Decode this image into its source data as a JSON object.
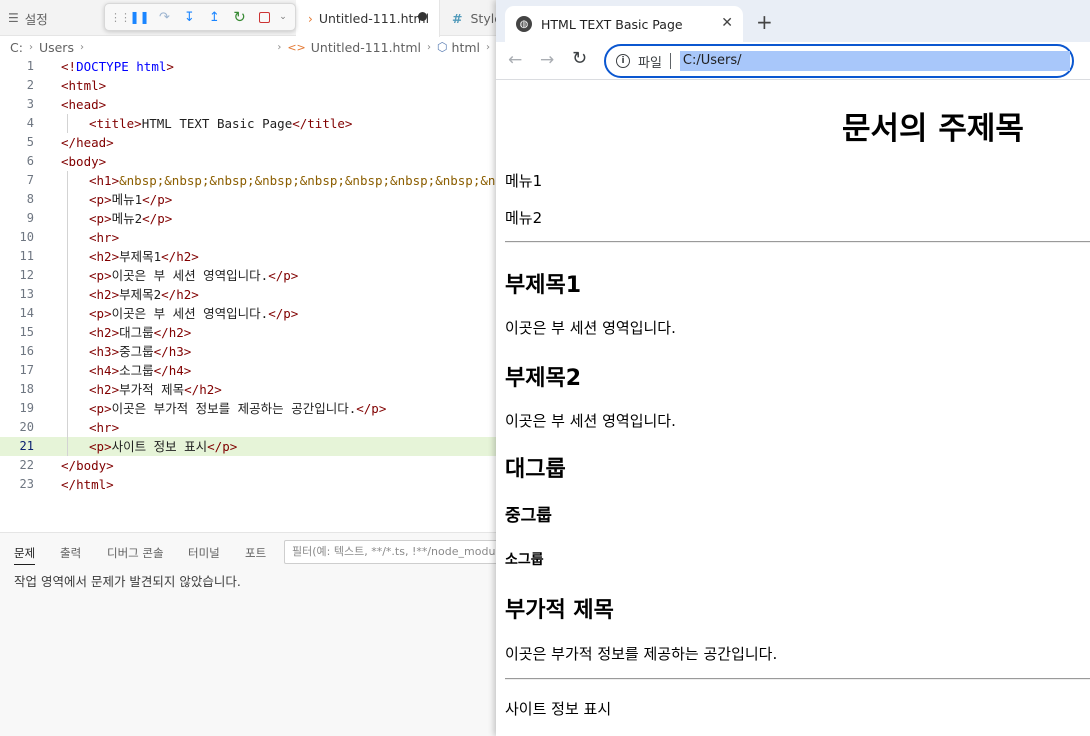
{
  "editor": {
    "tabs": {
      "settings": "설정",
      "file": "Untitled-111.html",
      "style": "Style"
    },
    "breadcrumb": {
      "drive": "C:",
      "users": "Users",
      "file": "Untitled-111.html",
      "node": "html"
    },
    "code_lines": [
      {
        "n": "1",
        "parts": [
          [
            "br",
            "<!"
          ],
          [
            "dt",
            "DOCTYPE"
          ],
          [
            "txt",
            " "
          ],
          [
            "dt",
            "html"
          ],
          [
            "br",
            ">"
          ]
        ]
      },
      {
        "n": "2",
        "parts": [
          [
            "br",
            "<"
          ],
          [
            "tg",
            "html"
          ],
          [
            "br",
            ">"
          ]
        ]
      },
      {
        "n": "3",
        "parts": [
          [
            "br",
            "<"
          ],
          [
            "tg",
            "head"
          ],
          [
            "br",
            ">"
          ]
        ]
      },
      {
        "n": "4",
        "indent": true,
        "parts": [
          [
            "br",
            "<"
          ],
          [
            "tg",
            "title"
          ],
          [
            "br",
            ">"
          ],
          [
            "txt",
            "HTML TEXT Basic Page"
          ],
          [
            "br",
            "</"
          ],
          [
            "tg",
            "title"
          ],
          [
            "br",
            ">"
          ]
        ]
      },
      {
        "n": "5",
        "parts": [
          [
            "br",
            "</"
          ],
          [
            "tg",
            "head"
          ],
          [
            "br",
            ">"
          ]
        ]
      },
      {
        "n": "6",
        "parts": [
          [
            "br",
            "<"
          ],
          [
            "tg",
            "body"
          ],
          [
            "br",
            ">"
          ]
        ]
      },
      {
        "n": "7",
        "indent": true,
        "parts": [
          [
            "br",
            "<"
          ],
          [
            "tg",
            "h1"
          ],
          [
            "br",
            ">"
          ],
          [
            "ent",
            "&nbsp;&nbsp;&nbsp;&nbsp;&nbsp;&nbsp;&nbsp;&nbsp;&nbsp;&"
          ]
        ]
      },
      {
        "n": "8",
        "indent": true,
        "parts": [
          [
            "br",
            "<"
          ],
          [
            "tg",
            "p"
          ],
          [
            "br",
            ">"
          ],
          [
            "txt",
            "메뉴1"
          ],
          [
            "br",
            "</"
          ],
          [
            "tg",
            "p"
          ],
          [
            "br",
            ">"
          ]
        ]
      },
      {
        "n": "9",
        "indent": true,
        "parts": [
          [
            "br",
            "<"
          ],
          [
            "tg",
            "p"
          ],
          [
            "br",
            ">"
          ],
          [
            "txt",
            "메뉴2"
          ],
          [
            "br",
            "</"
          ],
          [
            "tg",
            "p"
          ],
          [
            "br",
            ">"
          ]
        ]
      },
      {
        "n": "10",
        "indent": true,
        "parts": [
          [
            "br",
            "<"
          ],
          [
            "tg",
            "hr"
          ],
          [
            "br",
            ">"
          ]
        ]
      },
      {
        "n": "11",
        "indent": true,
        "parts": [
          [
            "br",
            "<"
          ],
          [
            "tg",
            "h2"
          ],
          [
            "br",
            ">"
          ],
          [
            "txt",
            "부제목1"
          ],
          [
            "br",
            "</"
          ],
          [
            "tg",
            "h2"
          ],
          [
            "br",
            ">"
          ]
        ]
      },
      {
        "n": "12",
        "indent": true,
        "parts": [
          [
            "br",
            "<"
          ],
          [
            "tg",
            "p"
          ],
          [
            "br",
            ">"
          ],
          [
            "txt",
            "이곳은 부 세션 영역입니다."
          ],
          [
            "br",
            "</"
          ],
          [
            "tg",
            "p"
          ],
          [
            "br",
            ">"
          ]
        ]
      },
      {
        "n": "13",
        "indent": true,
        "parts": [
          [
            "br",
            "<"
          ],
          [
            "tg",
            "h2"
          ],
          [
            "br",
            ">"
          ],
          [
            "txt",
            "부제목2"
          ],
          [
            "br",
            "</"
          ],
          [
            "tg",
            "h2"
          ],
          [
            "br",
            ">"
          ]
        ]
      },
      {
        "n": "14",
        "indent": true,
        "parts": [
          [
            "br",
            "<"
          ],
          [
            "tg",
            "p"
          ],
          [
            "br",
            ">"
          ],
          [
            "txt",
            "이곳은 부 세션 영역입니다."
          ],
          [
            "br",
            "</"
          ],
          [
            "tg",
            "p"
          ],
          [
            "br",
            ">"
          ]
        ]
      },
      {
        "n": "15",
        "indent": true,
        "parts": [
          [
            "br",
            "<"
          ],
          [
            "tg",
            "h2"
          ],
          [
            "br",
            ">"
          ],
          [
            "txt",
            "대그룹"
          ],
          [
            "br",
            "</"
          ],
          [
            "tg",
            "h2"
          ],
          [
            "br",
            ">"
          ]
        ]
      },
      {
        "n": "16",
        "indent": true,
        "parts": [
          [
            "br",
            "<"
          ],
          [
            "tg",
            "h3"
          ],
          [
            "br",
            ">"
          ],
          [
            "txt",
            "중그룹"
          ],
          [
            "br",
            "</"
          ],
          [
            "tg",
            "h3"
          ],
          [
            "br",
            ">"
          ]
        ]
      },
      {
        "n": "17",
        "indent": true,
        "parts": [
          [
            "br",
            "<"
          ],
          [
            "tg",
            "h4"
          ],
          [
            "br",
            ">"
          ],
          [
            "txt",
            "소그룹"
          ],
          [
            "br",
            "</"
          ],
          [
            "tg",
            "h4"
          ],
          [
            "br",
            ">"
          ]
        ]
      },
      {
        "n": "18",
        "indent": true,
        "parts": [
          [
            "br",
            "<"
          ],
          [
            "tg",
            "h2"
          ],
          [
            "br",
            ">"
          ],
          [
            "txt",
            "부가적 제목"
          ],
          [
            "br",
            "</"
          ],
          [
            "tg",
            "h2"
          ],
          [
            "br",
            ">"
          ]
        ]
      },
      {
        "n": "19",
        "indent": true,
        "parts": [
          [
            "br",
            "<"
          ],
          [
            "tg",
            "p"
          ],
          [
            "br",
            ">"
          ],
          [
            "txt",
            "이곳은 부가적 정보를 제공하는 공간입니다."
          ],
          [
            "br",
            "</"
          ],
          [
            "tg",
            "p"
          ],
          [
            "br",
            ">"
          ]
        ]
      },
      {
        "n": "20",
        "indent": true,
        "parts": [
          [
            "br",
            "<"
          ],
          [
            "tg",
            "hr"
          ],
          [
            "br",
            ">"
          ]
        ]
      },
      {
        "n": "21",
        "indent": true,
        "active": true,
        "parts": [
          [
            "br",
            "<"
          ],
          [
            "tg",
            "p"
          ],
          [
            "br",
            ">"
          ],
          [
            "txt",
            "사이트 정보 표시"
          ],
          [
            "br",
            "</"
          ],
          [
            "tg",
            "p"
          ],
          [
            "br",
            ">"
          ]
        ]
      },
      {
        "n": "22",
        "parts": [
          [
            "br",
            "</"
          ],
          [
            "tg",
            "body"
          ],
          [
            "br",
            ">"
          ]
        ]
      },
      {
        "n": "23",
        "parts": [
          [
            "br",
            "</"
          ],
          [
            "tg",
            "html"
          ],
          [
            "br",
            ">"
          ]
        ]
      }
    ],
    "panel": {
      "tabs": [
        "문제",
        "출력",
        "디버그 콘솔",
        "터미널",
        "포트"
      ],
      "filter_placeholder": "필터(예: 텍스트, **/*.ts, !**/node_modu",
      "message": "작업 영역에서 문제가 발견되지 않았습니다."
    }
  },
  "browser": {
    "tab_title": "HTML TEXT Basic Page",
    "site_label": "파일",
    "url": "C:/Users/",
    "page": {
      "h1": "문서의 주제목",
      "menu1": "메뉴1",
      "menu2": "메뉴2",
      "sub1": "부제목1",
      "sub1_text": "이곳은 부 세션 영역입니다.",
      "sub2": "부제목2",
      "sub2_text": "이곳은 부 세션 영역입니다.",
      "big_group": "대그룹",
      "mid_group": "중그룹",
      "small_group": "소그룹",
      "extra_title": "부가적 제목",
      "extra_text": "이곳은 부가적 정보를 제공하는 공간입니다.",
      "footer": "사이트 정보 표시"
    }
  },
  "colors": {
    "active_line": "#e6f4d8",
    "tag": "#800000",
    "doctype": "#0000ff",
    "omnibox_border": "#0b57d0",
    "url_selection": "#a8c7fa"
  }
}
